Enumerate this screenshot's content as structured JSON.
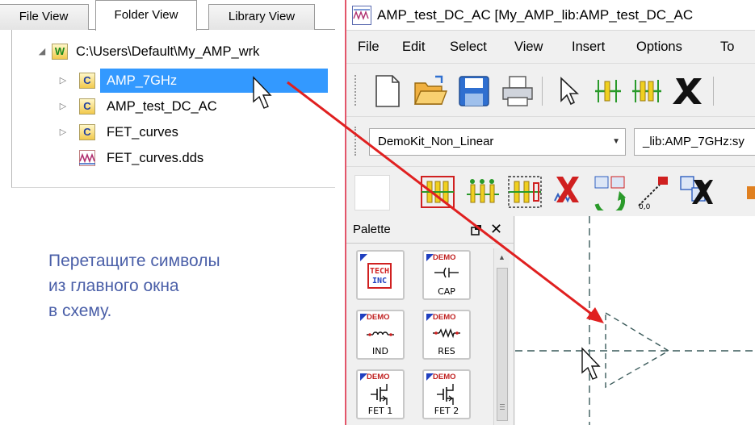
{
  "left_pane": {
    "tabs": [
      "File View",
      "Folder View",
      "Library View"
    ],
    "active_tab": "Folder View",
    "tree": {
      "root": "C:\\Users\\Default\\My_AMP_wrk",
      "items": [
        {
          "label": "AMP_7GHz",
          "icon": "cell-icon",
          "selected": true
        },
        {
          "label": "AMP_test_DC_AC",
          "icon": "cell-icon",
          "selected": false
        },
        {
          "label": "FET_curves",
          "icon": "cell-icon",
          "selected": false
        },
        {
          "label": "FET_curves.dds",
          "icon": "data-display-icon",
          "selected": false
        }
      ]
    },
    "instruction_lines": [
      "Перетащите символы",
      "из главного окна",
      "в схему."
    ]
  },
  "schematic_window": {
    "title": "AMP_test_DC_AC [My_AMP_lib:AMP_test_DC_AC",
    "menu": [
      "File",
      "Edit",
      "Select",
      "View",
      "Insert",
      "Options",
      "To"
    ],
    "toolbar": {
      "library_combo": "DemoKit_Non_Linear",
      "component_combo": "_lib:AMP_7GHz:sy"
    },
    "palette": {
      "title": "Palette",
      "items": [
        {
          "label": "TECH INC",
          "demo": false
        },
        {
          "label": "CAP",
          "demo": true
        },
        {
          "label": "IND",
          "demo": true
        },
        {
          "label": "RES",
          "demo": true
        },
        {
          "label": "FET 1",
          "demo": true
        },
        {
          "label": "FET 2",
          "demo": true
        }
      ],
      "demo_tag": "DEMO"
    }
  },
  "colors": {
    "selection": "#3399ff",
    "instruction_text": "#4a5fa8",
    "drag_arrow": "#e02020",
    "window_border": "#e3566a"
  }
}
